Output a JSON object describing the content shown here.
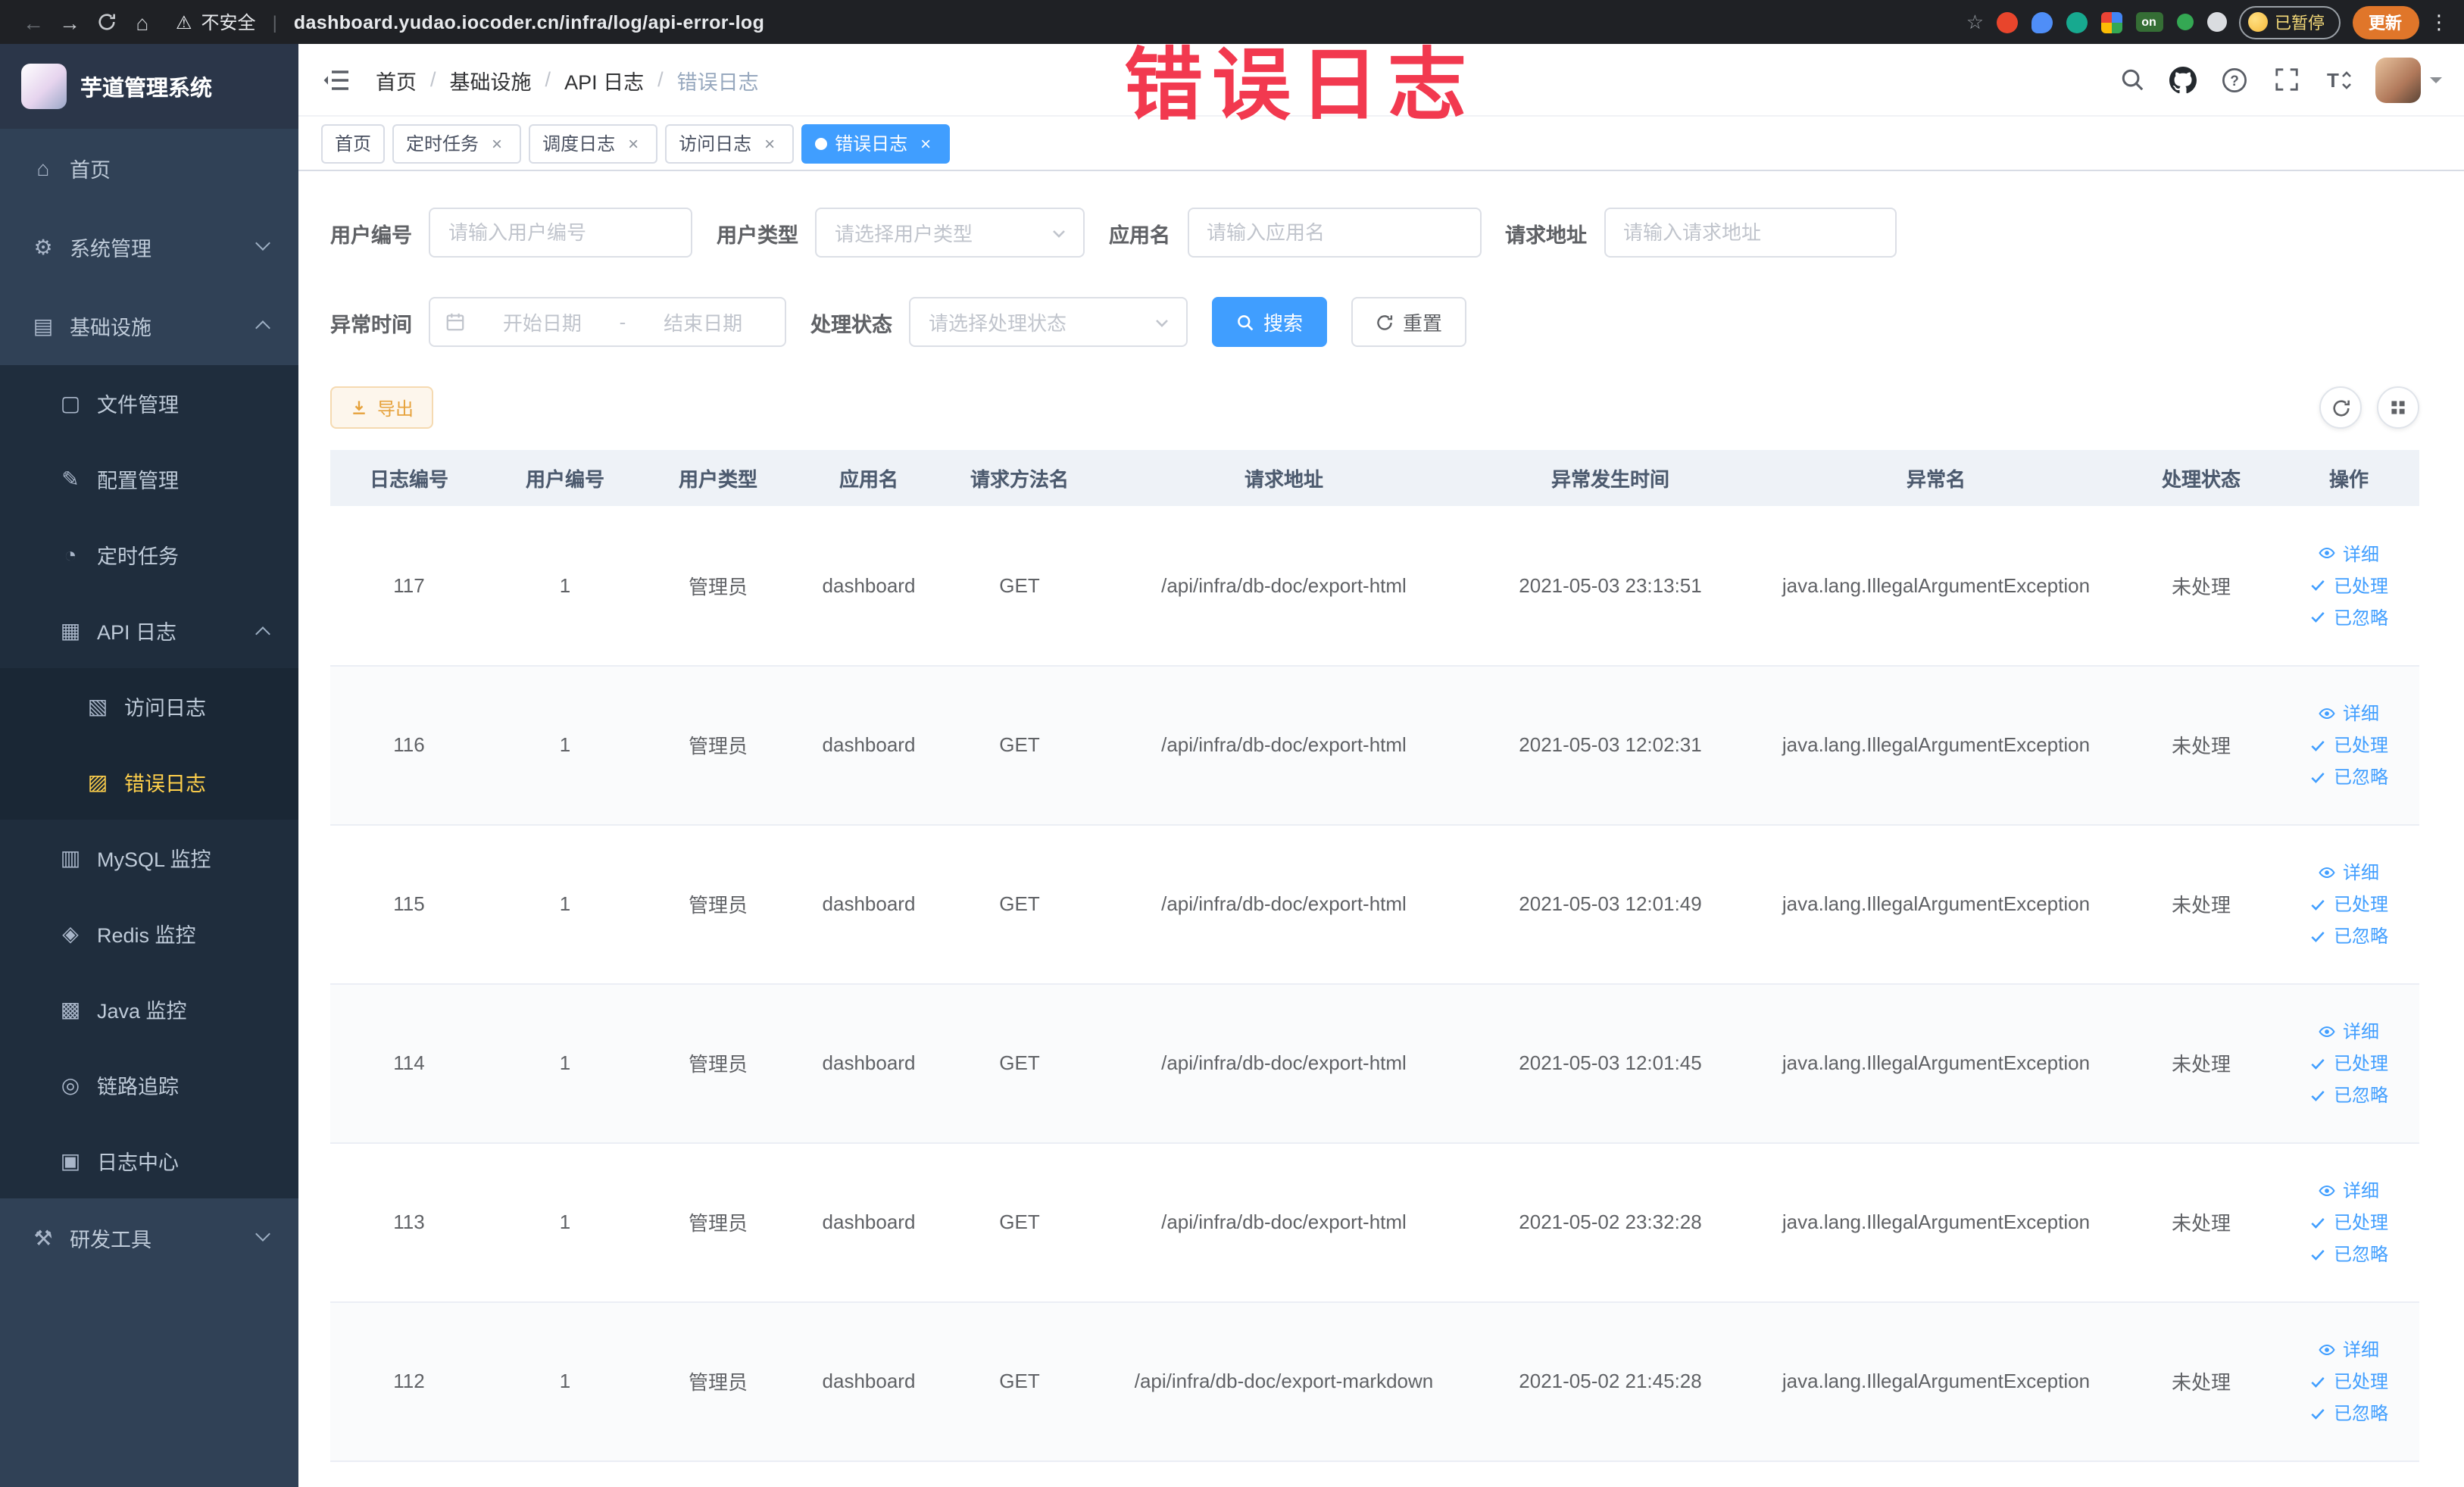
{
  "browser": {
    "security_label": "不安全",
    "url": "dashboard.yudao.iocoder.cn/infra/log/api-error-log",
    "extension_on_label": "on",
    "paused_label": "已暂停",
    "update_label": "更新"
  },
  "sidebar": {
    "logo_title": "芋道管理系统",
    "items": [
      {
        "label": "首页"
      },
      {
        "label": "系统管理"
      },
      {
        "label": "基础设施"
      },
      {
        "label": "文件管理"
      },
      {
        "label": "配置管理"
      },
      {
        "label": "定时任务"
      },
      {
        "label": "API 日志"
      },
      {
        "label": "访问日志"
      },
      {
        "label": "错误日志"
      },
      {
        "label": "MySQL 监控"
      },
      {
        "label": "Redis 监控"
      },
      {
        "label": "Java 监控"
      },
      {
        "label": "链路追踪"
      },
      {
        "label": "日志中心"
      },
      {
        "label": "研发工具"
      }
    ]
  },
  "breadcrumb": {
    "items": [
      "首页",
      "基础设施",
      "API 日志",
      "错误日志"
    ]
  },
  "tabs": [
    {
      "label": "首页"
    },
    {
      "label": "定时任务"
    },
    {
      "label": "调度日志"
    },
    {
      "label": "访问日志"
    },
    {
      "label": "错误日志"
    }
  ],
  "watermark": {
    "text": "错误日志"
  },
  "filters": {
    "user_id_label": "用户编号",
    "user_id_placeholder": "请输入用户编号",
    "user_type_label": "用户类型",
    "user_type_placeholder": "请选择用户类型",
    "app_name_label": "应用名",
    "app_name_placeholder": "请输入应用名",
    "request_url_label": "请求地址",
    "request_url_placeholder": "请输入请求地址",
    "exception_time_label": "异常时间",
    "start_date_placeholder": "开始日期",
    "end_date_placeholder": "结束日期",
    "range_separator": "-",
    "process_status_label": "处理状态",
    "process_status_placeholder": "请选择处理状态",
    "search_label": "搜索",
    "reset_label": "重置"
  },
  "toolbar": {
    "export_label": "导出"
  },
  "table": {
    "columns": [
      "日志编号",
      "用户编号",
      "用户类型",
      "应用名",
      "请求方法名",
      "请求地址",
      "异常发生时间",
      "异常名",
      "处理状态",
      "操作"
    ],
    "actions": [
      "详细",
      "已处理",
      "已忽略"
    ],
    "rows": [
      {
        "id": "117",
        "user_id": "1",
        "user_type": "管理员",
        "app": "dashboard",
        "method": "GET",
        "url": "/api/infra/db-doc/export-html",
        "time": "2021-05-03 23:13:51",
        "exception": "java.lang.IllegalArgumentException",
        "status": "未处理"
      },
      {
        "id": "116",
        "user_id": "1",
        "user_type": "管理员",
        "app": "dashboard",
        "method": "GET",
        "url": "/api/infra/db-doc/export-html",
        "time": "2021-05-03 12:02:31",
        "exception": "java.lang.IllegalArgumentException",
        "status": "未处理"
      },
      {
        "id": "115",
        "user_id": "1",
        "user_type": "管理员",
        "app": "dashboard",
        "method": "GET",
        "url": "/api/infra/db-doc/export-html",
        "time": "2021-05-03 12:01:49",
        "exception": "java.lang.IllegalArgumentException",
        "status": "未处理"
      },
      {
        "id": "114",
        "user_id": "1",
        "user_type": "管理员",
        "app": "dashboard",
        "method": "GET",
        "url": "/api/infra/db-doc/export-html",
        "time": "2021-05-03 12:01:45",
        "exception": "java.lang.IllegalArgumentException",
        "status": "未处理"
      },
      {
        "id": "113",
        "user_id": "1",
        "user_type": "管理员",
        "app": "dashboard",
        "method": "GET",
        "url": "/api/infra/db-doc/export-html",
        "time": "2021-05-02 23:32:28",
        "exception": "java.lang.IllegalArgumentException",
        "status": "未处理"
      },
      {
        "id": "112",
        "user_id": "1",
        "user_type": "管理员",
        "app": "dashboard",
        "method": "GET",
        "url": "/api/infra/db-doc/export-markdown",
        "time": "2021-05-02 21:45:28",
        "exception": "java.lang.IllegalArgumentException",
        "status": "未处理"
      }
    ]
  },
  "colors": {
    "primary": "#409eff",
    "sidebar_bg": "#304156",
    "sidebar_submenu_bg": "#1f2d3d",
    "active_menu_text": "#ffd04b",
    "active_tab_bg": "#409eff",
    "watermark": "#f2394f",
    "export_button_text": "#e6a23c",
    "update_button_bg": "#e0762a"
  }
}
